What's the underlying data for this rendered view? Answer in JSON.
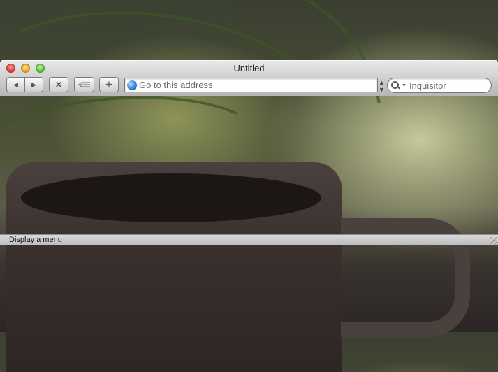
{
  "window": {
    "title": "Untitled"
  },
  "toolbar": {
    "back_icon": "back-arrow",
    "forward_icon": "forward-arrow",
    "stop_icon": "x-stop",
    "snapback_icon": "snapback",
    "add_icon": "plus",
    "back_label": "◀",
    "forward_label": "▶",
    "stop_label": "✕",
    "add_label": "+"
  },
  "address": {
    "placeholder": "Go to this address",
    "value": ""
  },
  "search": {
    "placeholder": "Inquisitor",
    "value": ""
  },
  "status": {
    "text": "Display a menu"
  },
  "colors": {
    "crosshair": "#c00000"
  }
}
